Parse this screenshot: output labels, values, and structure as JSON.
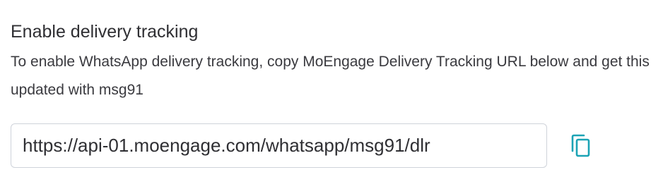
{
  "delivery_tracking": {
    "title": "Enable delivery tracking",
    "description": "To enable WhatsApp delivery tracking, copy MoEngage Delivery Tracking URL below and get this updated with msg91",
    "url_value": "https://api-01.moengage.com/whatsapp/msg91/dlr",
    "copy_icon": "copy-icon",
    "accent_color": "#1ba3b5"
  }
}
